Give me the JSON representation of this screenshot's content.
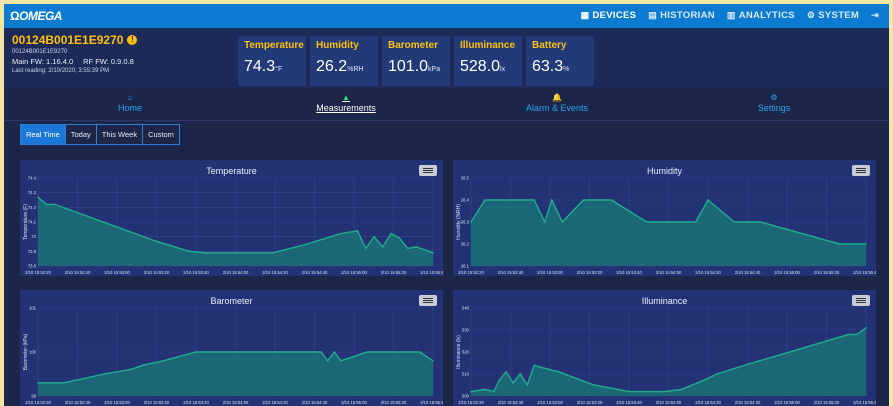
{
  "brand": {
    "logo": "OMEGA"
  },
  "nav": [
    {
      "label": "DEVICES",
      "icon": "grid-icon",
      "glyph": "▦"
    },
    {
      "label": "HISTORIAN",
      "icon": "database-icon",
      "glyph": "▤"
    },
    {
      "label": "ANALYTICS",
      "icon": "chart-icon",
      "glyph": "▥"
    },
    {
      "label": "SYSTEM",
      "icon": "gears-icon",
      "glyph": "⚙"
    },
    {
      "label": "",
      "icon": "sign-out-icon",
      "glyph": "⇥"
    }
  ],
  "device": {
    "id": "00124B001E1E9270",
    "serial": "00124B001E1E9270",
    "main_fw": "Main FW: 1.16.4.0",
    "rf_fw": "RF FW: 0.9.0.8",
    "last_reading": "Last reading: 2/10/2020, 3:55:39 PM"
  },
  "metrics": [
    {
      "label": "Temperature",
      "value": "74.3",
      "unit": "°F"
    },
    {
      "label": "Humidity",
      "value": "26.2",
      "unit": "%RH"
    },
    {
      "label": "Barometer",
      "value": "101.0",
      "unit": "kPa"
    },
    {
      "label": "Illuminance",
      "value": "528.0",
      "unit": "lx"
    },
    {
      "label": "Battery",
      "value": "63.3",
      "unit": "%"
    }
  ],
  "tabs": [
    {
      "label": "Home",
      "icon": "home-icon",
      "glyph": "⌂"
    },
    {
      "label": "Measurements",
      "icon": "area-chart-icon",
      "glyph": "▲"
    },
    {
      "label": "Alarm & Events",
      "icon": "bell-icon",
      "glyph": "🔔"
    },
    {
      "label": "Settings",
      "icon": "gear-icon",
      "glyph": "⚙"
    }
  ],
  "ranges": [
    "Real Time",
    "Today",
    "This Week",
    "Custom"
  ],
  "colors": {
    "accent": "#0a7bd0",
    "highlight": "#ffc107",
    "series": "#1fae8c",
    "panel": "#233275"
  },
  "chart_data": [
    {
      "type": "area",
      "title": "Temperature",
      "ylabel": "Temperature (F)",
      "ylim": [
        73.8,
        74.4
      ],
      "yticks": [
        "73.8",
        "73.9",
        "74",
        "74.1",
        "74.2",
        "74.3",
        "74.4"
      ],
      "xticks": [
        "2/10 15:52:20",
        "2/10 15:52:40",
        "2/10 15:53:00",
        "2/10 15:53:20",
        "2/10 15:53:40",
        "2/10 15:54:00",
        "2/10 15:54:20",
        "2/10 15:54:40",
        "2/10 15:55:00",
        "2/10 15:55:20",
        "2/10 15:55:40"
      ],
      "x": [
        0,
        5,
        10,
        70,
        90,
        100,
        140,
        160,
        180,
        190,
        195,
        200,
        205,
        210,
        215,
        220,
        225,
        235
      ],
      "values": [
        74.27,
        74.22,
        74.22,
        73.97,
        73.9,
        73.89,
        73.89,
        73.95,
        74.02,
        74.04,
        73.92,
        74.0,
        73.93,
        74.02,
        73.99,
        73.92,
        73.93,
        73.89
      ]
    },
    {
      "type": "area",
      "title": "Humidity",
      "ylabel": "Humidity (%RH)",
      "ylim": [
        26.1,
        26.5
      ],
      "yticks": [
        "26.1",
        "26.2",
        "26.3",
        "26.4",
        "26.5"
      ],
      "xticks": [
        "2/10 15:52:20",
        "2/10 15:52:40",
        "2/10 15:53:00",
        "2/10 15:53:20",
        "2/10 15:53:40",
        "2/10 15:54:00",
        "2/10 15:54:20",
        "2/10 15:54:40",
        "2/10 15:55:00",
        "2/10 15:55:20",
        "2/10 15:55:40"
      ],
      "x": [
        0,
        8,
        36,
        42,
        46,
        52,
        64,
        80,
        100,
        128,
        135,
        150,
        165,
        210,
        225
      ],
      "values": [
        26.3,
        26.4,
        26.4,
        26.3,
        26.4,
        26.3,
        26.4,
        26.4,
        26.3,
        26.3,
        26.4,
        26.3,
        26.3,
        26.2,
        26.2
      ]
    },
    {
      "type": "area",
      "title": "Barometer",
      "ylabel": "Barometer (kPa)",
      "ylim": [
        99,
        101
      ],
      "yticks": [
        "99",
        "100",
        "101"
      ],
      "xticks": [
        "2/10 15:52:20",
        "2/10 15:52:40",
        "2/10 15:53:00",
        "2/10 15:53:20",
        "2/10 15:53:40",
        "2/10 15:54:00",
        "2/10 15:54:20",
        "2/10 15:54:40",
        "2/10 15:55:00",
        "2/10 15:55:20",
        "2/10 15:55:40"
      ],
      "x": [
        0,
        10,
        20,
        35,
        50,
        70,
        80,
        95,
        120,
        150,
        180,
        200,
        210,
        215,
        220,
        225,
        230,
        250,
        275,
        290,
        300
      ],
      "values": [
        99.3,
        99.3,
        99.3,
        99.4,
        99.5,
        99.6,
        99.7,
        99.8,
        100.0,
        100.0,
        100.0,
        100.0,
        100.0,
        100.0,
        99.8,
        100.0,
        99.8,
        100.0,
        100.0,
        100.0,
        99.8
      ]
    },
    {
      "type": "area",
      "title": "Illuminance",
      "ylabel": "Illuminance (lx)",
      "ylim": [
        500,
        540
      ],
      "yticks": [
        "500",
        "510",
        "520",
        "530",
        "540"
      ],
      "xticks": [
        "2/10 15:52:20",
        "2/10 15:52:40",
        "2/10 15:53:00",
        "2/10 15:53:20",
        "2/10 15:53:40",
        "2/10 15:54:00",
        "2/10 15:54:20",
        "2/10 15:54:40",
        "2/10 15:55:00",
        "2/10 15:55:20",
        "2/10 15:55:40"
      ],
      "x": [
        0,
        8,
        13,
        16,
        20,
        24,
        28,
        32,
        36,
        40,
        50,
        70,
        90,
        110,
        120,
        135,
        140,
        160,
        190,
        215,
        220,
        225
      ],
      "values": [
        502,
        503,
        502,
        507,
        511,
        506,
        510,
        505,
        514,
        513,
        511,
        505,
        502,
        502,
        503,
        508,
        510,
        515,
        522,
        528,
        528,
        531
      ]
    }
  ]
}
